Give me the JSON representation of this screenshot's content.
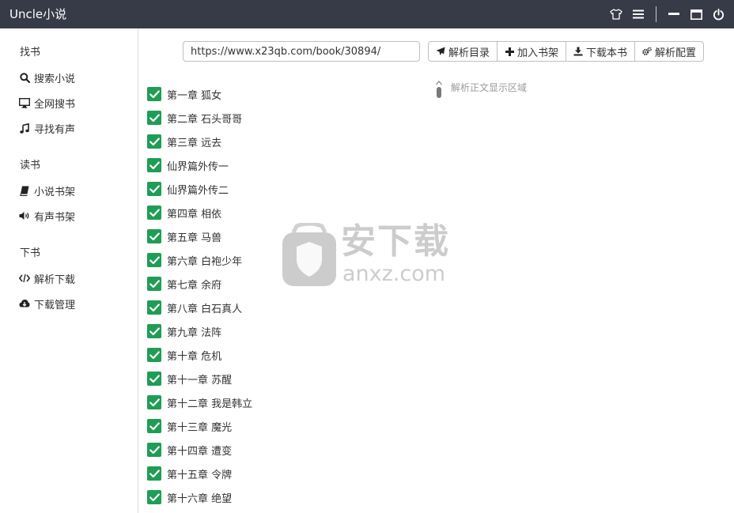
{
  "app": {
    "title": "Uncle小说"
  },
  "titlebar": {
    "icons": [
      "shirt-icon",
      "menu-icon",
      "minimize-icon",
      "maximize-icon",
      "power-icon"
    ]
  },
  "sidebar": {
    "sections": [
      {
        "title": "找书",
        "items": [
          {
            "label": "搜索小说",
            "icon": "search-icon"
          },
          {
            "label": "全网搜书",
            "icon": "monitor-icon"
          },
          {
            "label": "寻找有声",
            "icon": "music-icon"
          }
        ]
      },
      {
        "title": "读书",
        "items": [
          {
            "label": "小说书架",
            "icon": "book-icon"
          },
          {
            "label": "有声书架",
            "icon": "volume-icon"
          }
        ]
      },
      {
        "title": "下书",
        "items": [
          {
            "label": "解析下载",
            "icon": "code-icon"
          },
          {
            "label": "下载管理",
            "icon": "cloud-download-icon"
          }
        ]
      }
    ]
  },
  "toolbar": {
    "url_value": "https://www.x23qb.com/book/30894/",
    "buttons": [
      {
        "label": "解析目录",
        "icon": "send-icon"
      },
      {
        "label": "加入书架",
        "icon": "plus-icon"
      },
      {
        "label": "下载本书",
        "icon": "download-icon"
      },
      {
        "label": "解析配置",
        "icon": "gears-icon"
      }
    ]
  },
  "chapters": [
    "第一章 狐女",
    "第二章 石头哥哥",
    "第三章 远去",
    "仙界篇外传一",
    "仙界篇外传二",
    "第四章 相依",
    "第五章 马兽",
    "第六章 白袍少年",
    "第七章 余府",
    "第八章 白石真人",
    "第九章 法阵",
    "第十章 危机",
    "第十一章 苏醒",
    "第十二章 我是韩立",
    "第十三章 魔光",
    "第十四章 遭变",
    "第十五章 令牌",
    "第十六章 绝望"
  ],
  "content": {
    "hint": "解析正文显示区域"
  },
  "watermark": {
    "text": "安下载",
    "domain": "anxz.com"
  },
  "colors": {
    "titlebar": "#373b47",
    "checkbox": "#1f9d55"
  }
}
